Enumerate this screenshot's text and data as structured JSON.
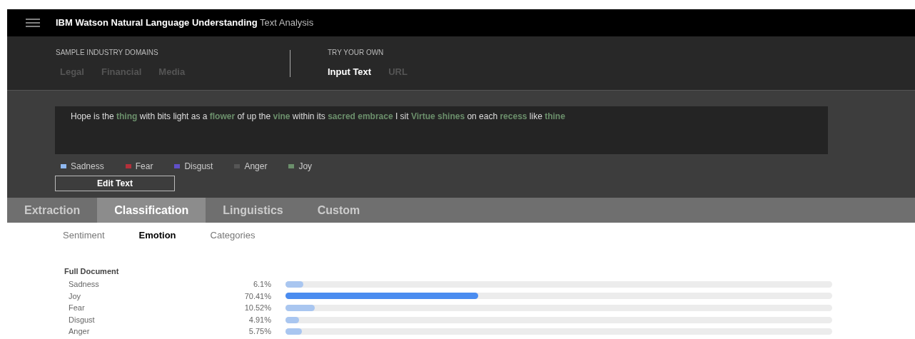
{
  "header": {
    "title": "IBM Watson Natural Language Understanding",
    "subtitle": "Text Analysis"
  },
  "sample_domains": {
    "label": "SAMPLE INDUSTRY DOMAINS",
    "items": [
      {
        "label": "Legal",
        "selected": false
      },
      {
        "label": "Financial",
        "selected": false
      },
      {
        "label": "Media",
        "selected": false
      }
    ]
  },
  "try_your_own": {
    "label": "TRY YOUR OWN",
    "items": [
      {
        "label": "Input Text",
        "selected": true
      },
      {
        "label": "URL",
        "selected": false
      }
    ]
  },
  "passage": [
    {
      "text": "Hope is the ",
      "kind": "plain"
    },
    {
      "text": "thing",
      "kind": "joy"
    },
    {
      "text": " with bits light as a ",
      "kind": "plain"
    },
    {
      "text": "flower",
      "kind": "joy"
    },
    {
      "text": " of up the ",
      "kind": "plain"
    },
    {
      "text": "vine",
      "kind": "joy"
    },
    {
      "text": " within its ",
      "kind": "plain"
    },
    {
      "text": "sacred embrace",
      "kind": "joy"
    },
    {
      "text": " I sit ",
      "kind": "plain"
    },
    {
      "text": "Virtue shines",
      "kind": "joy"
    },
    {
      "text": " on each ",
      "kind": "plain"
    },
    {
      "text": "recess",
      "kind": "joy"
    },
    {
      "text": " like ",
      "kind": "plain"
    },
    {
      "text": "thine",
      "kind": "joy"
    }
  ],
  "legend": [
    {
      "label": "Sadness",
      "color": "#8fb8f0"
    },
    {
      "label": "Fear",
      "color": "#b3303a"
    },
    {
      "label": "Disgust",
      "color": "#6050c8"
    },
    {
      "label": "Anger",
      "color": "#555555"
    },
    {
      "label": "Joy",
      "color": "#6b8f6b"
    }
  ],
  "edit_button": "Edit Text",
  "tabs": [
    {
      "label": "Extraction",
      "selected": false
    },
    {
      "label": "Classification",
      "selected": true
    },
    {
      "label": "Linguistics",
      "selected": false
    },
    {
      "label": "Custom",
      "selected": false
    }
  ],
  "subtabs": [
    {
      "label": "Sentiment",
      "selected": false
    },
    {
      "label": "Emotion",
      "selected": true
    },
    {
      "label": "Categories",
      "selected": false
    }
  ],
  "section_title": "Full Document",
  "emotions": [
    {
      "name": "Sadness",
      "reading": "6.1%",
      "level": 0.032,
      "highlighted": false
    },
    {
      "name": "Joy",
      "reading": "70.41%",
      "level": 0.352,
      "highlighted": true
    },
    {
      "name": "Fear",
      "reading": "10.52%",
      "level": 0.053,
      "highlighted": false
    },
    {
      "name": "Disgust",
      "reading": "4.91%",
      "level": 0.025,
      "highlighted": false
    },
    {
      "name": "Anger",
      "reading": "5.75%",
      "level": 0.03,
      "highlighted": false
    }
  ]
}
